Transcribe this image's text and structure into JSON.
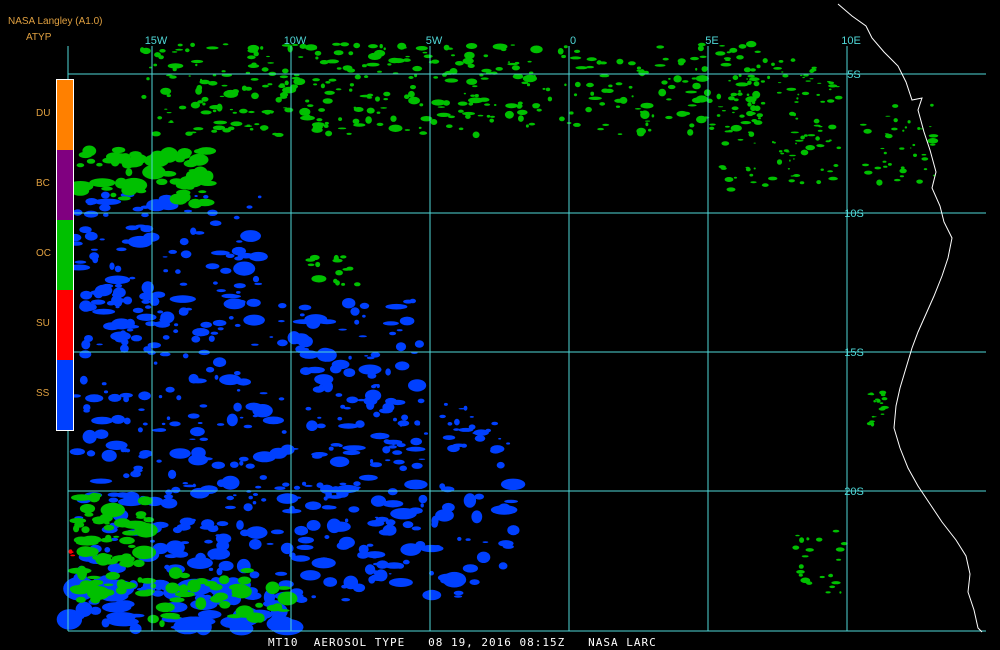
{
  "header": {
    "title": "NASA Langley (A1.0)",
    "product": "ATYP"
  },
  "legend": {
    "items": [
      {
        "code": "DU",
        "color": "#ff8000"
      },
      {
        "code": "BC",
        "color": "#800080"
      },
      {
        "code": "OC",
        "color": "#00c000"
      },
      {
        "code": "SU",
        "color": "#ff0000"
      },
      {
        "code": "SS",
        "color": "#0040ff"
      }
    ]
  },
  "map": {
    "lon_labels": [
      "15W",
      "10W",
      "5W",
      "0",
      "5E",
      "10E"
    ],
    "lat_labels": [
      "5S",
      "10S",
      "15S",
      "20S"
    ],
    "grid_color": "#4fd7d7",
    "coast_color": "#ffffff",
    "background": "#000000"
  },
  "footer": {
    "text": "MT10  AEROSOL TYPE   08 19, 2016 08:15Z   NASA LARC"
  }
}
